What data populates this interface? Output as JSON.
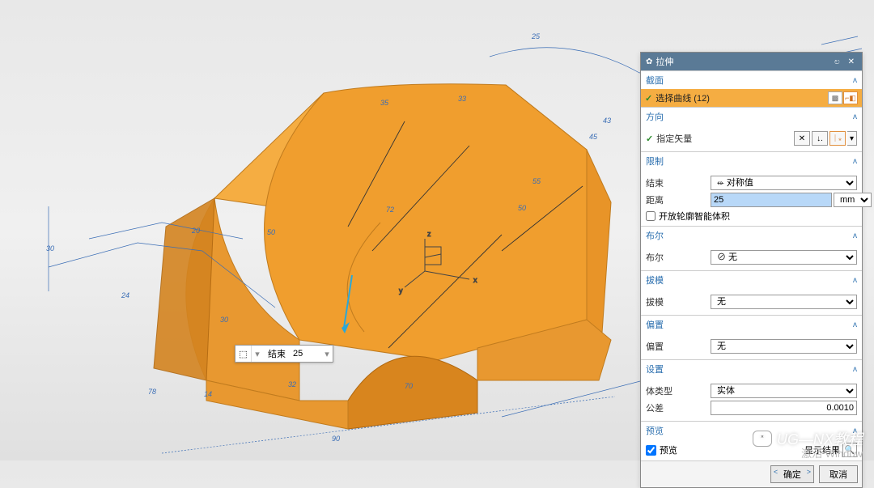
{
  "panel": {
    "title": "拉伸",
    "sections": {
      "section": {
        "title": "截面",
        "select_curve_prefix": "选择曲线 (",
        "select_count": 12,
        "select_curve_suffix": ")"
      },
      "direction": {
        "title": "方向",
        "specify_vector": "指定矢量"
      },
      "limit": {
        "title": "限制",
        "end_label": "结束",
        "end_value": "对称值",
        "distance_label": "距离",
        "distance_value": "25",
        "unit": "mm",
        "open_label": "开放轮廓智能体积"
      },
      "boolean": {
        "title": "布尔",
        "label": "布尔",
        "value": "无"
      },
      "draft": {
        "title": "拔模",
        "label": "拔模",
        "value": "无"
      },
      "offset": {
        "title": "偏置",
        "label": "偏置",
        "value": "无"
      },
      "settings": {
        "title": "设置",
        "body_type_label": "体类型",
        "body_type_value": "实体",
        "tolerance_label": "公差",
        "tolerance_value": "0.0010"
      },
      "preview": {
        "title": "预览",
        "preview_label": "预览",
        "show_result": "显示结果"
      }
    },
    "ok": "确定",
    "cancel": "取消"
  },
  "floating": {
    "end_label": "结束",
    "end_value": "25"
  },
  "dimensions": {
    "d1": "30",
    "d2": "24",
    "d3": "30",
    "d4": "50",
    "d5": "72",
    "d6": "35",
    "d7": "33",
    "d8": "50",
    "d9": "78",
    "d10": "14",
    "d11": "32",
    "d12": "70",
    "d13": "90",
    "d14": "55",
    "d15": "45",
    "d16": "25",
    "d17": "20",
    "d18": "43"
  },
  "axes": {
    "x": "x",
    "y": "y",
    "z": "z"
  },
  "signature": "UG—NX教程",
  "activate": "激活 Window"
}
